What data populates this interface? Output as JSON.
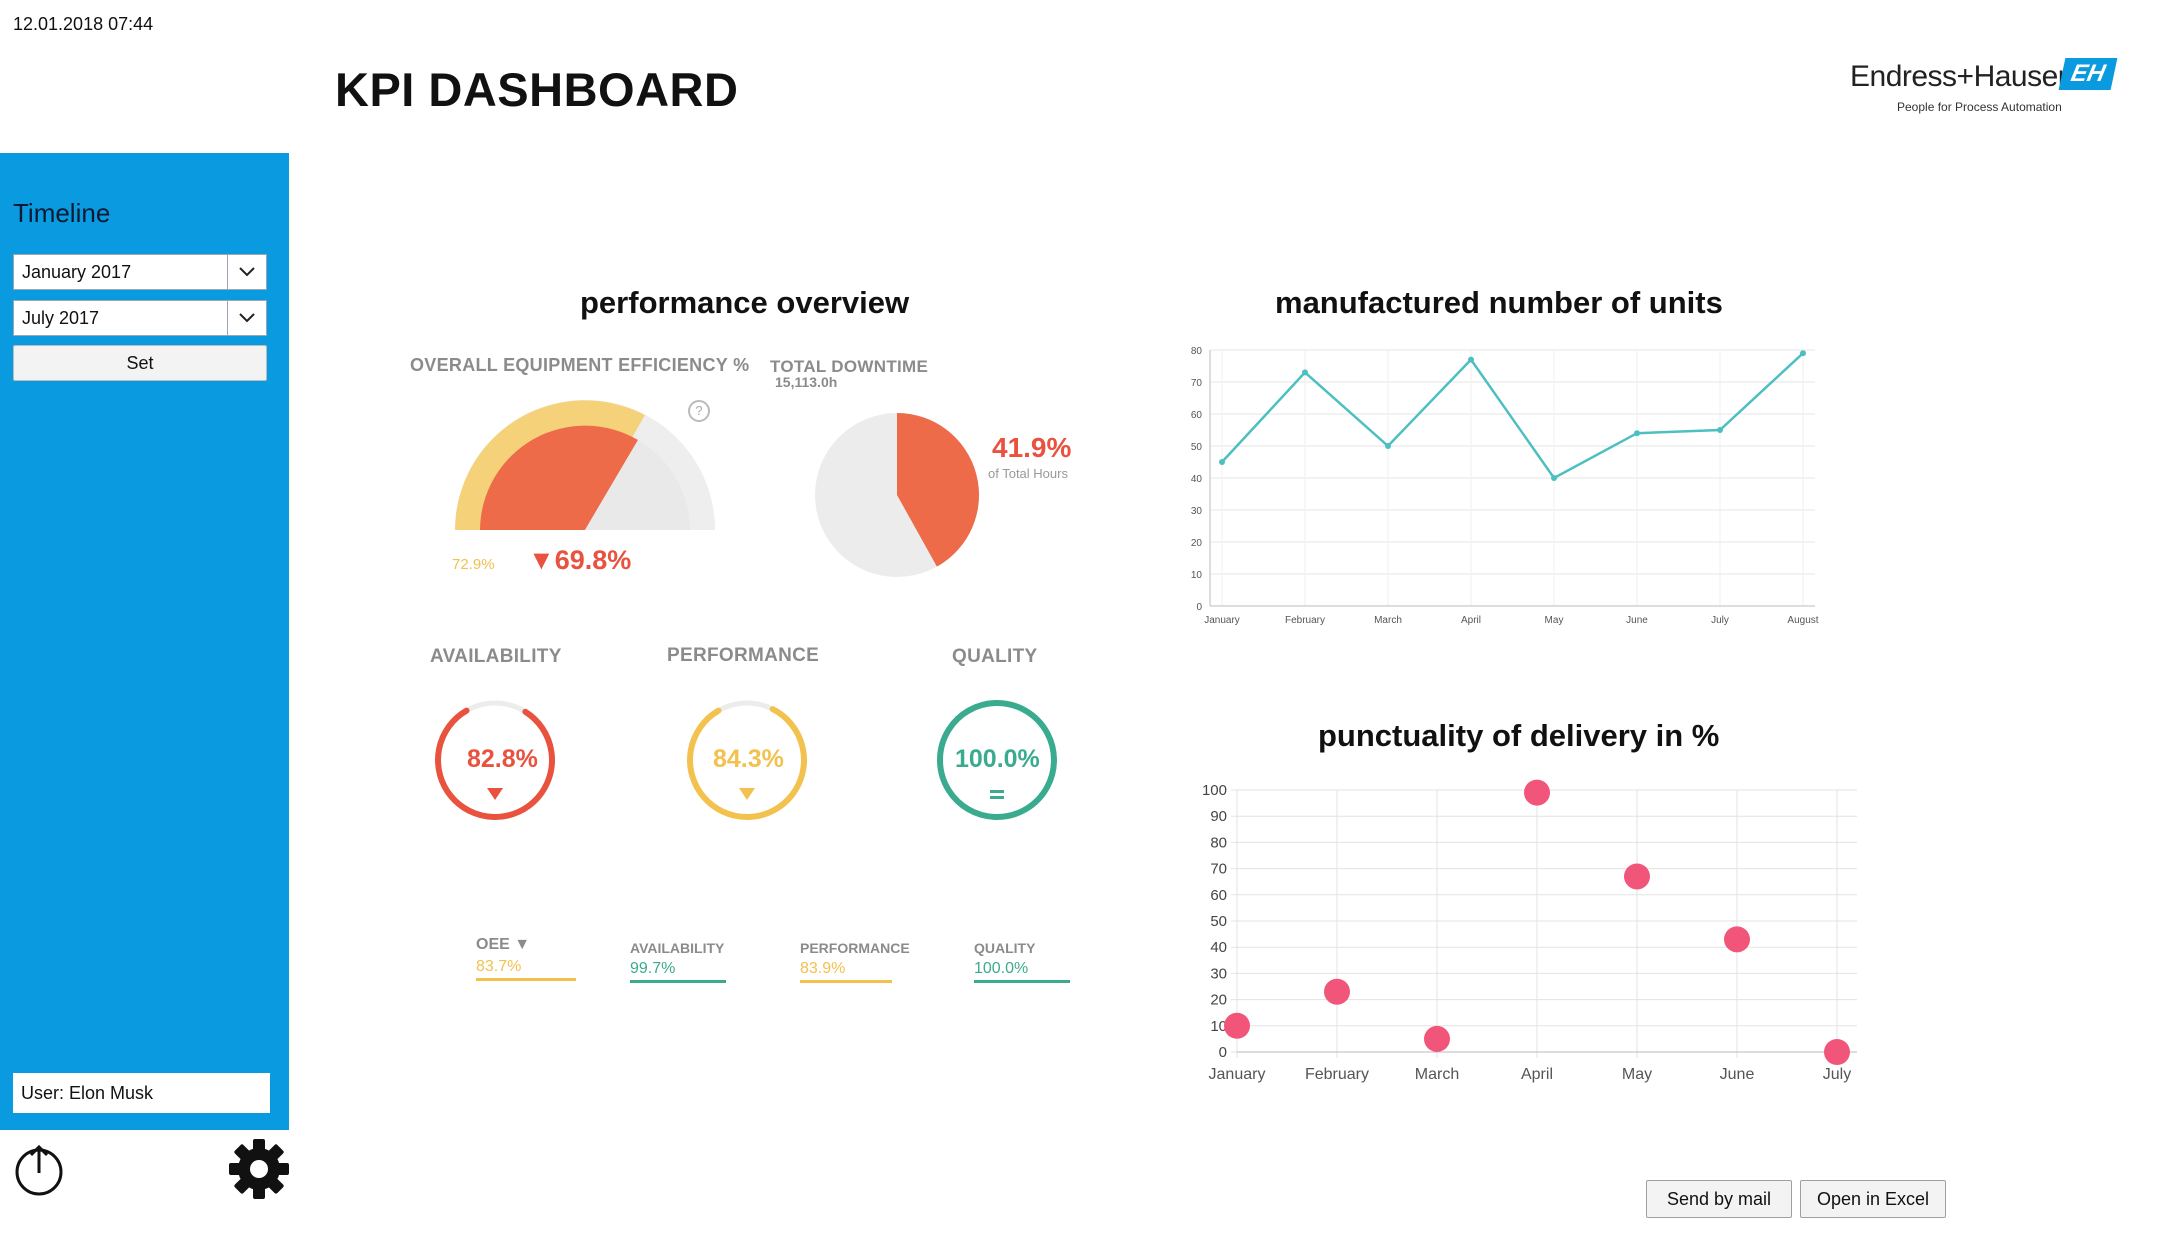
{
  "datetime": "12.01.2018 07:44",
  "page_title": "KPI DASHBOARD",
  "brand": {
    "name": "Endress+Hauser",
    "tagline": "People for Process Automation",
    "mark": "EH",
    "color": "#0a9ae0"
  },
  "sidebar": {
    "timeline_label": "Timeline",
    "from_value": "January 2017",
    "to_value": "July 2017",
    "set_label": "Set",
    "user_label": "User: Elon Musk",
    "color": "#0a9ae0"
  },
  "performance": {
    "title": "performance overview",
    "oee_label": "OVERALL EQUIPMENT EFFICIENCY %",
    "downtime_label": "TOTAL DOWNTIME",
    "downtime_hours": "15,113.0h",
    "oee_value": "▼69.8%",
    "oee_prev": "72.9%",
    "downtime_pct": "41.9%",
    "downtime_sub": "of Total Hours",
    "availability": {
      "label": "AVAILABILITY",
      "value": "82.8%",
      "fraction": 0.828,
      "color": "#e8523f"
    },
    "performance": {
      "label": "PERFORMANCE",
      "value": "84.3%",
      "fraction": 0.843,
      "color": "#f2c14e"
    },
    "quality": {
      "label": "QUALITY",
      "value": "100.0%",
      "fraction": 1.0,
      "color": "#3bab8f"
    },
    "summary": [
      {
        "label": "OEE ▼",
        "value": "83.7%",
        "color": "#f2c14e"
      },
      {
        "label": "AVAILABILITY",
        "value": "99.7%",
        "color": "#3bab8f"
      },
      {
        "label": "PERFORMANCE",
        "value": "83.9%",
        "color": "#f2c14e"
      },
      {
        "label": "QUALITY",
        "value": "100.0%",
        "color": "#3bab8f"
      }
    ]
  },
  "chart_data": [
    {
      "type": "line",
      "title": "manufactured number of units",
      "categories": [
        "January",
        "February",
        "March",
        "April",
        "May",
        "June",
        "July",
        "August"
      ],
      "series": [
        {
          "values": [
            45,
            73,
            50,
            77,
            40,
            54,
            55,
            79
          ]
        }
      ],
      "ylim": [
        0,
        80
      ],
      "yticks": [
        0,
        10,
        20,
        30,
        40,
        50,
        60,
        70,
        80
      ],
      "color": "#4ebfc0"
    },
    {
      "type": "scatter",
      "title": "punctuality of delivery in %",
      "categories": [
        "January",
        "February",
        "March",
        "April",
        "May",
        "June",
        "July"
      ],
      "series": [
        {
          "values": [
            10,
            23,
            5,
            99,
            67,
            43,
            0
          ]
        }
      ],
      "ylim": [
        0,
        100
      ],
      "yticks": [
        0,
        10,
        20,
        30,
        40,
        50,
        60,
        70,
        80,
        90,
        100
      ],
      "color": "#f2557a"
    }
  ],
  "actions": {
    "mail_label": "Send by mail",
    "excel_label": "Open in Excel"
  }
}
